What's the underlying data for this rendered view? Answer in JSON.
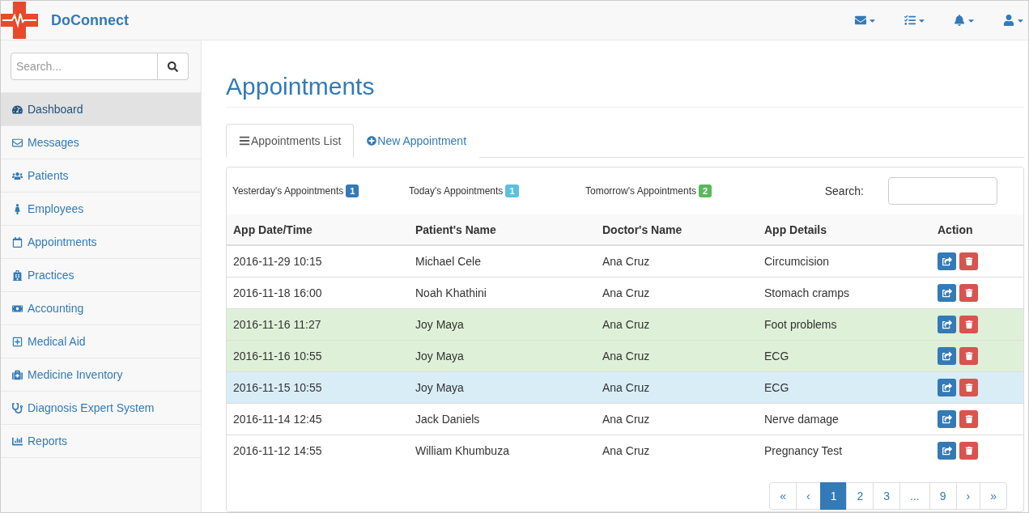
{
  "brand": "DoConnect",
  "sidebar": {
    "search": {
      "placeholder": "Search..."
    },
    "items": [
      {
        "label": "Dashboard",
        "selected": true
      },
      {
        "label": "Messages",
        "selected": false
      },
      {
        "label": "Patients",
        "selected": false
      },
      {
        "label": "Employees",
        "selected": false
      },
      {
        "label": "Appointments",
        "selected": false
      },
      {
        "label": "Practices",
        "selected": false
      },
      {
        "label": "Accounting",
        "selected": false
      },
      {
        "label": "Medical Aid",
        "selected": false
      },
      {
        "label": "Medicine Inventory",
        "selected": false
      },
      {
        "label": "Diagnosis Expert System",
        "selected": false
      },
      {
        "label": "Reports",
        "selected": false
      }
    ]
  },
  "page_title": "Appointments",
  "tabs": [
    {
      "label": "Appointments List",
      "selected": true
    },
    {
      "label": "New Appointment",
      "selected": false
    }
  ],
  "summary": [
    {
      "label": "Yesterday's Appointments",
      "count": "1",
      "color": "#337ab7"
    },
    {
      "label": "Today's Appointments",
      "count": "1",
      "color": "#5bc0de"
    },
    {
      "label": "Tomorrow's Appointments",
      "count": "2",
      "color": "#5cb85c"
    }
  ],
  "table_search": {
    "label": "Search:"
  },
  "table": {
    "columns": [
      "App Date/Time",
      "Patient's Name",
      "Doctor's Name",
      "App Details",
      "Action"
    ],
    "rows": [
      {
        "cells": [
          "2016-11-29 10:15",
          "Michael Cele",
          "Ana Cruz",
          "Circumcision"
        ],
        "color": "#ffffff"
      },
      {
        "cells": [
          "2016-11-18 16:00",
          "Noah Khathini",
          "Ana Cruz",
          "Stomach cramps"
        ],
        "color": "#ffffff"
      },
      {
        "cells": [
          "2016-11-16 11:27",
          "Joy Maya",
          "Ana Cruz",
          "Foot problems"
        ],
        "color": "#dff0d8"
      },
      {
        "cells": [
          "2016-11-16 10:55",
          "Joy Maya",
          "Ana Cruz",
          "ECG"
        ],
        "color": "#dff0d8"
      },
      {
        "cells": [
          "2016-11-15 10:55",
          "Joy Maya",
          "Ana Cruz",
          "ECG"
        ],
        "color": "#d9edf7"
      },
      {
        "cells": [
          "2016-11-14 12:45",
          "Jack Daniels",
          "Ana Cruz",
          "Nerve damage"
        ],
        "color": "#ffffff"
      },
      {
        "cells": [
          "2016-11-12 14:55",
          "William Khumbuza",
          "Ana Cruz",
          "Pregnancy Test"
        ],
        "color": "#ffffff"
      }
    ]
  },
  "pagination": [
    {
      "label": "«",
      "selected": false
    },
    {
      "label": "‹",
      "selected": false
    },
    {
      "label": "1",
      "selected": true
    },
    {
      "label": "2",
      "selected": false
    },
    {
      "label": "3",
      "selected": false
    },
    {
      "label": "...",
      "selected": false
    },
    {
      "label": "9",
      "selected": false
    },
    {
      "label": "›",
      "selected": false
    },
    {
      "label": "»",
      "selected": false
    }
  ]
}
